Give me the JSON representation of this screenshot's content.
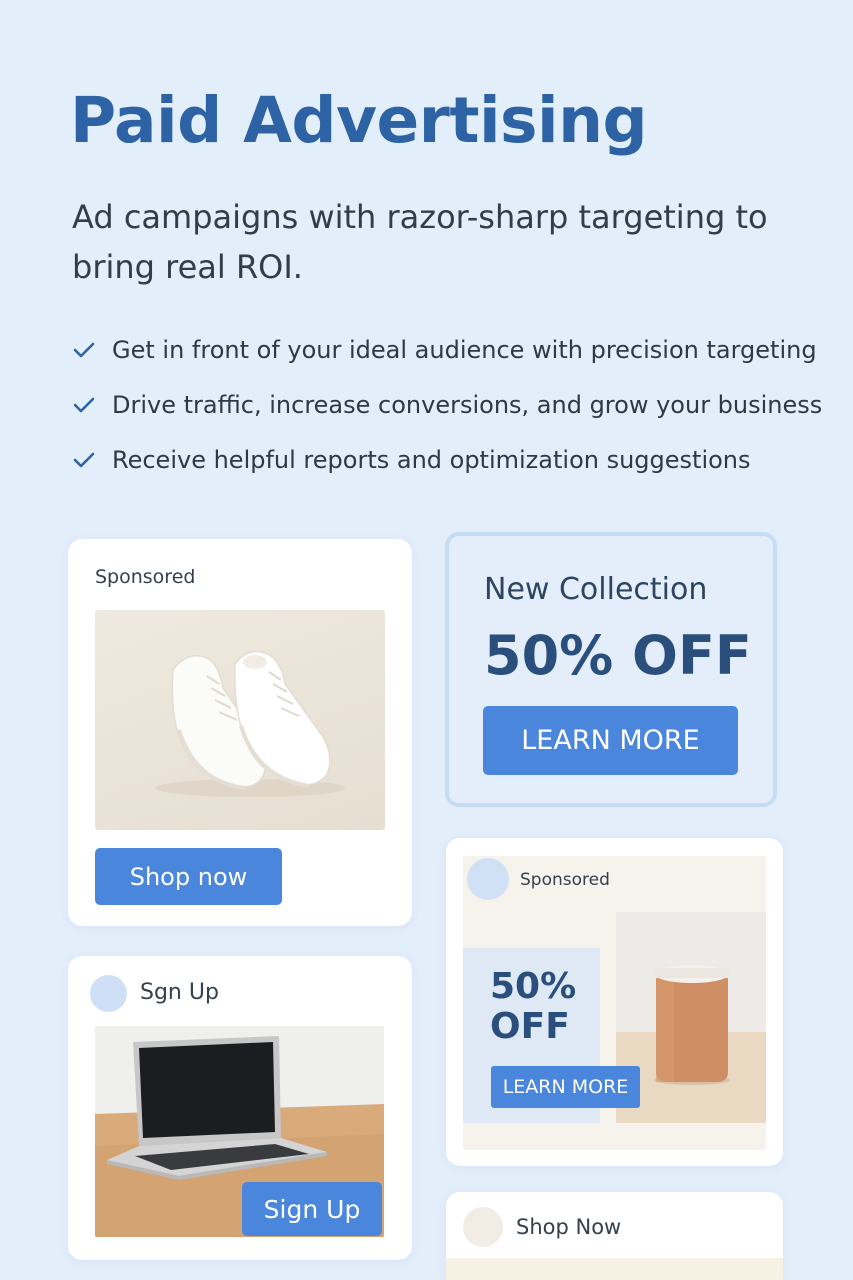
{
  "header": {
    "title": "Paid Advertising",
    "subtitle": "Ad campaigns with razor-sharp targeting to bring real ROI."
  },
  "features": [
    {
      "icon": "check-icon",
      "text": "Get in front of your ideal audience with precision targeting"
    },
    {
      "icon": "check-icon",
      "text": "Drive traffic, increase conversions, and grow your business"
    },
    {
      "icon": "check-icon",
      "text": "Receive helpful reports and optimization suggestions"
    }
  ],
  "ad_sneakers": {
    "label": "Sponsored",
    "image": "white-sneakers-image",
    "button": "Shop now"
  },
  "ad_collection": {
    "heading": "New Collection",
    "offer": "50% OFF",
    "button": "LEARN MORE"
  },
  "ad_signup": {
    "label": "Sgn Up",
    "image": "laptop-on-desk-image",
    "button": "Sign Up"
  },
  "ad_jar": {
    "label": "Sponsored",
    "offer_line1": "50%",
    "offer_line2": "OFF",
    "button": "LEARN MORE",
    "image": "terracotta-jar-image"
  },
  "ad_shopnow": {
    "label": "Shop Now"
  },
  "colors": {
    "background": "#e3eefb",
    "title": "#2d63a4",
    "button": "#4a86dc",
    "offer_text": "#2a4f7c"
  }
}
